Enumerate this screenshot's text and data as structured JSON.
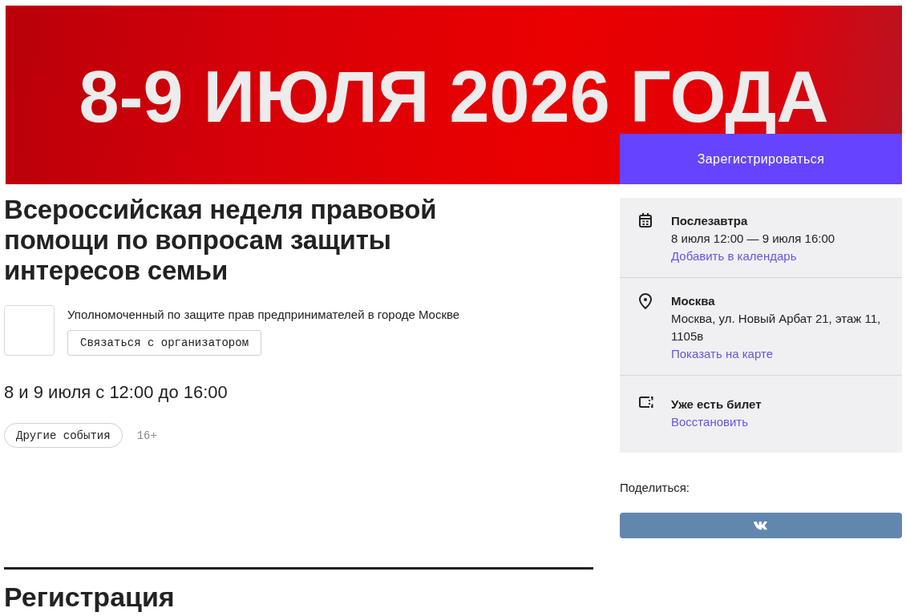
{
  "banner": {
    "text": "8-9 ИЮЛЯ 2026 ГОДА"
  },
  "register_button": "Зарегистрироваться",
  "event": {
    "title": "Всероссийская неделя правовой помощи по вопросам защиты интересов семьи",
    "organizer": {
      "name": "Уполномоченный по защите прав предпринимателей в городе Москве",
      "contact_button": "Связаться с организатором"
    },
    "schedule": "8 и 9 июля с 12:00 до 16:00",
    "other_events_button": "Другие события",
    "age_rating": "16+"
  },
  "info_panel": {
    "items": [
      {
        "kind": "date",
        "title": "Послезавтра",
        "lines": [
          "8 июля 12:00 — 9 июля 16:00"
        ],
        "link": "Добавить в календарь"
      },
      {
        "kind": "location",
        "title": "Москва",
        "lines": [
          "Москва, ул. Новый Арбат 21, этаж 11, 1105в"
        ],
        "link": "Показать на карте"
      },
      {
        "kind": "ticket",
        "title": "Уже есть билет",
        "link": "Восстановить"
      }
    ]
  },
  "share": {
    "label": "Поделиться:",
    "buttons": [
      {
        "kind": "vk"
      }
    ]
  },
  "registration_section": {
    "heading": "Регистрация"
  }
}
